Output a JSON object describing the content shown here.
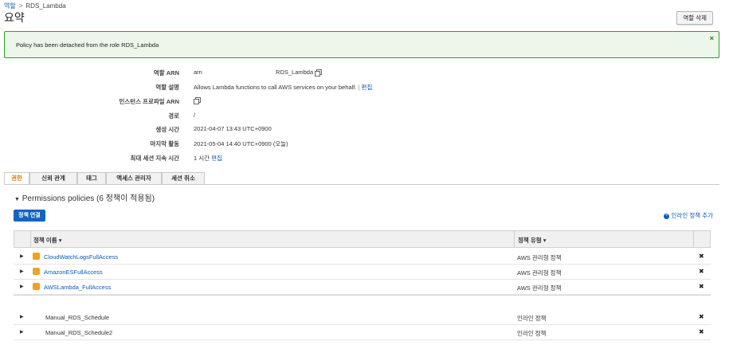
{
  "breadcrumb": {
    "parent": "역할",
    "separator": ">",
    "current": "RDS_Lambda"
  },
  "page": {
    "title": "요약",
    "delete_role_label": "역할 삭제"
  },
  "alert": {
    "message": "Policy has been detached from the role RDS_Lambda",
    "close_glyph": "×"
  },
  "summary": [
    {
      "label": "역할 ARN",
      "value": "arn",
      "value2": "RDS_Lambda",
      "copy": true
    },
    {
      "label": "역할 설명",
      "value": "Allows Lambda functions to call AWS services on your behalf.",
      "link": "편집",
      "sep": "|"
    },
    {
      "label": "인스턴스 프로파일 ARN",
      "value": "",
      "copy": true
    },
    {
      "label": "경로",
      "value": "/"
    },
    {
      "label": "생성 시간",
      "value": "2021-04-07 13:43 UTC+0900"
    },
    {
      "label": "마지막 활동",
      "value": "2021-05-04 14:40 UTC+0900 (오늘)"
    },
    {
      "label": "최대 세션 지속 시간",
      "value": "1 시간",
      "link": "편집"
    }
  ],
  "tabs": [
    "권한",
    "신뢰 관계",
    "태그",
    "액세스 관리자",
    "세션 취소"
  ],
  "active_tab": "권한",
  "permissions": {
    "header": "Permissions policies (6 정책이 적용됨)",
    "attach_label": "정책 연결",
    "add_inline_label": "인라인 정책 추가",
    "col_name": "정책 이름 ▾",
    "col_type": "정책 유형 ▾",
    "rows": [
      {
        "name": "CloudWatchLogsFullAccess",
        "type": "AWS 관리형 정책",
        "managed": true
      },
      {
        "name": "AmazonESFullAccess",
        "type": "AWS 관리형 정책",
        "managed": true
      },
      {
        "name": "AWSLambda_FullAccess",
        "type": "AWS 관리형 정책",
        "managed": true
      },
      {
        "name": "Manual_RDS_Schedule",
        "type": "인라인 정책",
        "managed": false
      },
      {
        "name": "Manual_RDS_Schedule2",
        "type": "인라인 정책",
        "managed": false
      }
    ]
  },
  "colors": {
    "link": "#0a58b8",
    "accent_tab": "#e07b00",
    "primary_button": "#1165c1",
    "success_border": "#2d9f2a",
    "success_bg": "#ecf6ea",
    "policy_icon": "#f2a01f"
  }
}
